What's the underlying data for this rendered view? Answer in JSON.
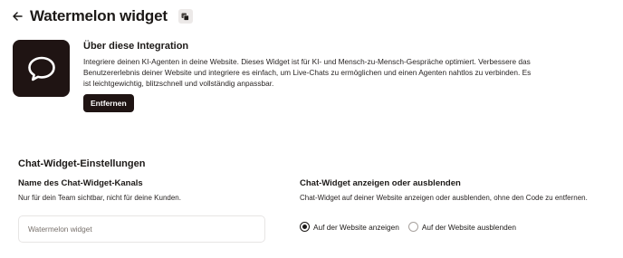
{
  "header": {
    "title": "Watermelon widget",
    "back_icon": "arrow-left-icon",
    "copy_icon": "copy-icon"
  },
  "integration": {
    "icon": "chat-bubble-icon",
    "about_title": "Über diese Integration",
    "about_description": "Integriere deinen KI-Agenten in deine Website. Dieses Widget ist für KI- und Mensch-zu-Mensch-Gespräche optimiert. Verbessere das Benutzererlebnis deiner Website und integriere es einfach, um Live-Chats zu ermöglichen und einen Agenten nahtlos zu verbinden. Es ist leichtgewichtig, blitzschnell und vollständig anpassbar.",
    "remove_label": "Entfernen",
    "brand_color": "#1f1413"
  },
  "settings": {
    "title": "Chat-Widget-Einstellungen",
    "channel_name": {
      "label": "Name des Chat-Widget-Kanals",
      "description": "Nur für dein Team sichtbar, nicht für deine Kunden.",
      "value": "",
      "placeholder": "Watermelon widget"
    },
    "visibility": {
      "label": "Chat-Widget anzeigen oder ausblenden",
      "description": "Chat-Widget auf deiner Website anzeigen oder ausblenden, ohne den Code zu entfernen.",
      "options": [
        {
          "label": "Auf der Website anzeigen",
          "selected": true
        },
        {
          "label": "Auf der Website ausblenden",
          "selected": false
        }
      ]
    }
  }
}
